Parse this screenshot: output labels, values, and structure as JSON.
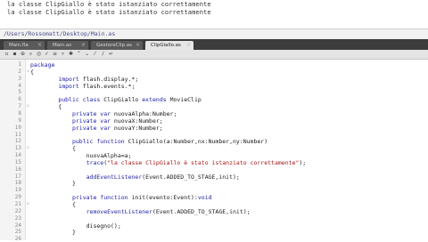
{
  "output": {
    "lines": [
      "la classe ClipGiallo è stato istanziato correttamente",
      "la classe ClipGiallo è stato istanziato correttamente"
    ]
  },
  "path": "/Users/Rossomatt/Desktop/Main.as",
  "tabs": [
    {
      "label": "Main.fla",
      "active": false
    },
    {
      "label": "Main.as",
      "active": false
    },
    {
      "label": "GestoreClip.as",
      "active": false
    },
    {
      "label": "ClipGiallo.as",
      "active": true
    }
  ],
  "toolbar_icons": [
    "new-file-icon",
    "open-icon",
    "save-icon",
    "find-icon",
    "target-icon",
    "check-syntax-icon",
    "auto-format-icon",
    "code-hint-icon",
    "debug-icon",
    "collapse-icon",
    "expand-icon",
    "comment-icon",
    "uncomment-icon",
    "wrap-icon"
  ],
  "code": {
    "line_numbers": [
      "1",
      "2",
      "3",
      "4",
      "5",
      "6",
      "7",
      "8",
      "9",
      "10",
      "11",
      "12",
      "13",
      "14",
      "15",
      "16",
      "17",
      "18",
      "19",
      "20",
      "21",
      "22",
      "23",
      "24",
      "25",
      "26"
    ],
    "lines": [
      {
        "segments": [
          {
            "t": "package",
            "c": "kw"
          }
        ]
      },
      {
        "segments": [
          {
            "t": "{",
            "c": ""
          }
        ]
      },
      {
        "segments": [
          {
            "t": "        ",
            "c": ""
          },
          {
            "t": "import",
            "c": "kw"
          },
          {
            "t": " flash.display.*;",
            "c": ""
          }
        ]
      },
      {
        "segments": [
          {
            "t": "        ",
            "c": ""
          },
          {
            "t": "import",
            "c": "kw"
          },
          {
            "t": " flash.events.*;",
            "c": ""
          }
        ]
      },
      {
        "segments": [
          {
            "t": "",
            "c": ""
          }
        ]
      },
      {
        "segments": [
          {
            "t": "        ",
            "c": ""
          },
          {
            "t": "public class",
            "c": "kw"
          },
          {
            "t": " ClipGiallo ",
            "c": ""
          },
          {
            "t": "extends",
            "c": "kw"
          },
          {
            "t": " MovieClip",
            "c": ""
          }
        ]
      },
      {
        "segments": [
          {
            "t": "        {",
            "c": ""
          }
        ]
      },
      {
        "segments": [
          {
            "t": "            ",
            "c": ""
          },
          {
            "t": "private var",
            "c": "kw"
          },
          {
            "t": " nuovaAlpha:Number;",
            "c": ""
          }
        ]
      },
      {
        "segments": [
          {
            "t": "            ",
            "c": ""
          },
          {
            "t": "private var",
            "c": "kw"
          },
          {
            "t": " nuovaX:Number;",
            "c": ""
          }
        ]
      },
      {
        "segments": [
          {
            "t": "            ",
            "c": ""
          },
          {
            "t": "private var",
            "c": "kw"
          },
          {
            "t": " nuovaY:Number;",
            "c": ""
          }
        ]
      },
      {
        "segments": [
          {
            "t": "",
            "c": ""
          }
        ]
      },
      {
        "segments": [
          {
            "t": "            ",
            "c": ""
          },
          {
            "t": "public function",
            "c": "kw"
          },
          {
            "t": " ClipGiallo(a:Number,nx:Number,ny:Number)",
            "c": ""
          }
        ]
      },
      {
        "segments": [
          {
            "t": "            {",
            "c": ""
          }
        ]
      },
      {
        "segments": [
          {
            "t": "                nuovaAlpha=a;",
            "c": ""
          }
        ]
      },
      {
        "segments": [
          {
            "t": "                ",
            "c": ""
          },
          {
            "t": "trace",
            "c": "fn"
          },
          {
            "t": "(",
            "c": ""
          },
          {
            "t": "\"la classe ClipGiallo è stato istanziato correttamente\"",
            "c": "str"
          },
          {
            "t": ");",
            "c": ""
          }
        ]
      },
      {
        "segments": [
          {
            "t": "",
            "c": ""
          }
        ]
      },
      {
        "segments": [
          {
            "t": "                ",
            "c": ""
          },
          {
            "t": "addEventListener",
            "c": "fn"
          },
          {
            "t": "(Event.ADDED_TO_STAGE,init);",
            "c": ""
          }
        ]
      },
      {
        "segments": [
          {
            "t": "            }",
            "c": ""
          }
        ]
      },
      {
        "segments": [
          {
            "t": "",
            "c": ""
          }
        ]
      },
      {
        "segments": [
          {
            "t": "            ",
            "c": ""
          },
          {
            "t": "private function",
            "c": "kw"
          },
          {
            "t": " init(evento:Event):",
            "c": ""
          },
          {
            "t": "void",
            "c": "kw"
          }
        ]
      },
      {
        "segments": [
          {
            "t": "            {",
            "c": ""
          }
        ]
      },
      {
        "segments": [
          {
            "t": "                ",
            "c": ""
          },
          {
            "t": "removeEventListener",
            "c": "fn"
          },
          {
            "t": "(Event.ADDED_TO_STAGE,init);",
            "c": ""
          }
        ]
      },
      {
        "segments": [
          {
            "t": "",
            "c": ""
          }
        ]
      },
      {
        "segments": [
          {
            "t": "                disegno();",
            "c": ""
          }
        ]
      },
      {
        "segments": [
          {
            "t": "            }",
            "c": ""
          }
        ]
      },
      {
        "segments": [
          {
            "t": "",
            "c": ""
          }
        ]
      }
    ]
  }
}
